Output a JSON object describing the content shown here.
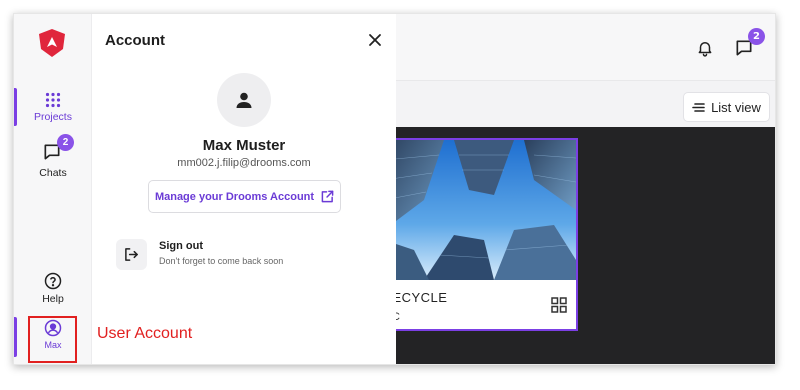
{
  "colors": {
    "accent": "#7b3fe4",
    "annotation": "#e12020",
    "dark_bg": "#232325"
  },
  "header": {
    "bell_icon": "bell-icon",
    "chat_icon": "chat-bubble-icon",
    "chat_badge": "2"
  },
  "toolbar": {
    "list_view_label": "List view",
    "list_view_icon": "list-lines-icon"
  },
  "card": {
    "title": "FECYCLE",
    "subtitle": "UC",
    "view_icon": "grid-icon"
  },
  "sidebar": {
    "logo": "drooms-shield-logo",
    "items": [
      {
        "label": "Projects",
        "icon": "grid-dots-icon",
        "active": true
      },
      {
        "label": "Chats",
        "icon": "chat-bubble-icon",
        "badge": "2"
      },
      {
        "label": "Help",
        "icon": "help-circle-icon"
      },
      {
        "label": "Max",
        "icon": "user-circle-icon",
        "active": true
      }
    ]
  },
  "account_panel": {
    "title": "Account",
    "close_icon": "close-icon",
    "user_name": "Max Muster",
    "user_email": "mm002.j.filip@drooms.com",
    "manage_label": "Manage your Drooms Account",
    "manage_icon": "external-link-icon",
    "signout_title": "Sign out",
    "signout_subtitle": "Don't forget to come back soon",
    "signout_icon": "sign-out-icon"
  },
  "annotation": {
    "text": "User Account"
  }
}
